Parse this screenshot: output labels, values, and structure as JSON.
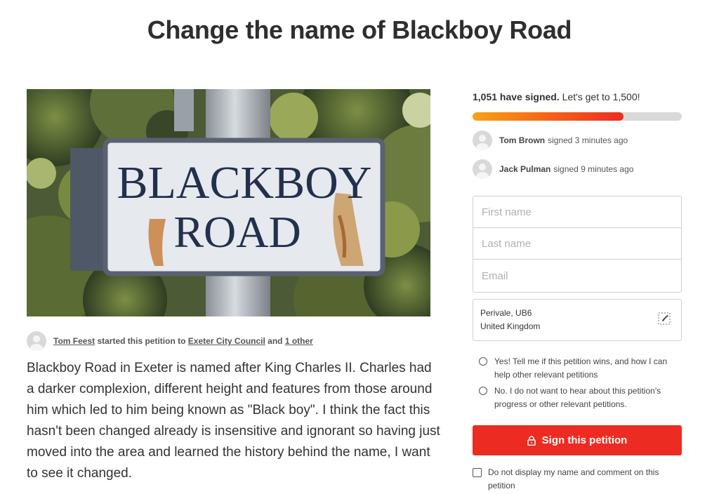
{
  "page": {
    "title": "Change the name of Blackboy Road"
  },
  "image": {
    "sign_line1": "BLACKBOY",
    "sign_line2": "ROAD"
  },
  "starter": {
    "name": "Tom Feest",
    "started_text": " started this petition to ",
    "target": "Exeter City Council",
    "and_text": " and ",
    "others": "1 other"
  },
  "description": "Blackboy Road in Exeter is named after King Charles II. Charles had a darker complexion, different height and features from those around him which led to him being known as \"Black boy\". I think the fact this hasn't been changed already is insensitive and ignorant so having just moved into the area and learned the history behind the name, I want to see it changed.",
  "progress": {
    "count_text": "1,051 have signed.",
    "goal_text": " Let's get to 1,500!",
    "signed": 1051,
    "goal": 1500,
    "fill_fraction": 0.72
  },
  "recent_signers": [
    {
      "name": "Tom Brown",
      "time": "signed 3 minutes ago"
    },
    {
      "name": "Jack Pulman",
      "time": "signed 9 minutes ago"
    }
  ],
  "form": {
    "first_name_placeholder": "First name",
    "last_name_placeholder": "Last name",
    "email_placeholder": "Email",
    "location_line1": "Perivale, UB6",
    "location_line2": "United Kingdom"
  },
  "options": {
    "yes_label": "Yes! Tell me if this petition wins, and how I can help other relevant petitions",
    "no_label": "No. I do not want to hear about this petition's progress or other relevant petitions."
  },
  "sign_button": {
    "label": "Sign this petition"
  },
  "hide_name": {
    "label": "Do not display my name and comment on this petition"
  },
  "colors": {
    "accent": "#ec2c22",
    "progress_start": "#f7a21b",
    "progress_end": "#ec2c22"
  },
  "icons": {
    "lock": "lock-icon",
    "edit": "edit-pencil-icon",
    "avatar": "user-avatar-icon"
  }
}
